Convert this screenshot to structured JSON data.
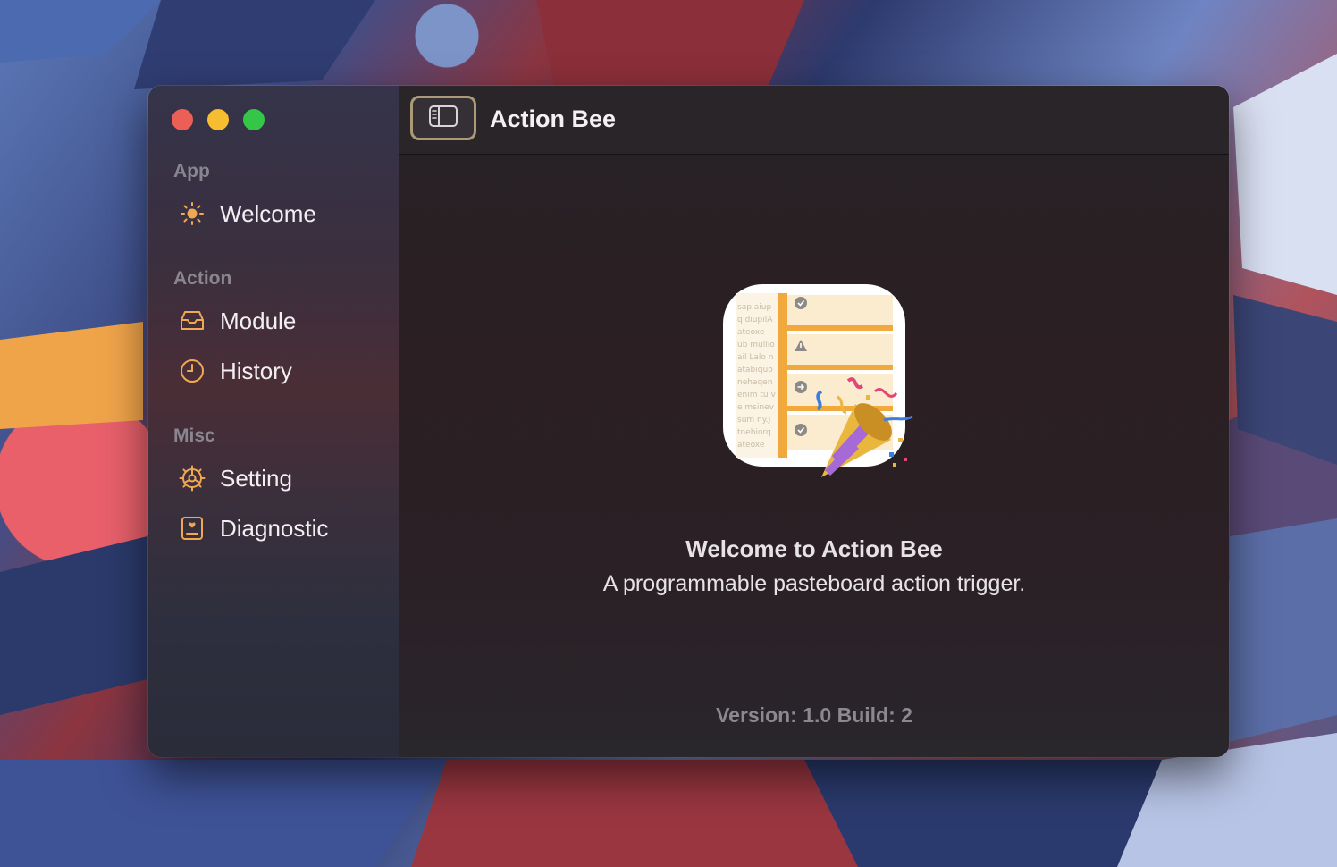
{
  "window": {
    "title": "Action Bee"
  },
  "sidebar": {
    "sections": [
      {
        "label": "App",
        "items": [
          {
            "label": "Welcome",
            "icon": "sun-icon"
          }
        ]
      },
      {
        "label": "Action",
        "items": [
          {
            "label": "Module",
            "icon": "tray-icon"
          },
          {
            "label": "History",
            "icon": "clock-icon"
          }
        ]
      },
      {
        "label": "Misc",
        "items": [
          {
            "label": "Setting",
            "icon": "gear-icon"
          },
          {
            "label": "Diagnostic",
            "icon": "report-icon"
          }
        ]
      }
    ]
  },
  "main": {
    "welcome_title": "Welcome to Action Bee",
    "welcome_subtitle": "A programmable pasteboard action trigger.",
    "version_text": "Version: 1.0 Build: 2"
  },
  "colors": {
    "accent": "#f0a952",
    "close": "#ec5f57",
    "minimize": "#f5bd2f",
    "maximize": "#35c648"
  }
}
